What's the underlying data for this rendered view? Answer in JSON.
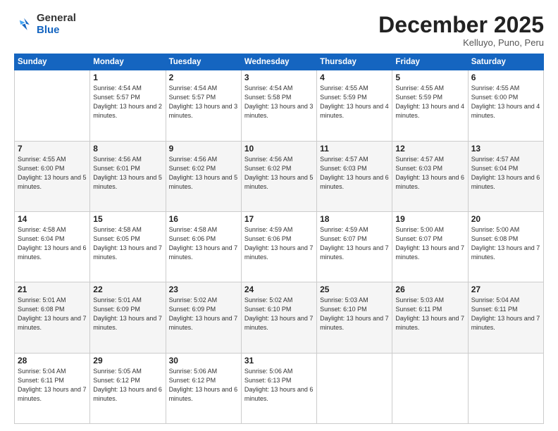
{
  "logo": {
    "general": "General",
    "blue": "Blue"
  },
  "header": {
    "month": "December 2025",
    "location": "Kelluyo, Puno, Peru"
  },
  "days_of_week": [
    "Sunday",
    "Monday",
    "Tuesday",
    "Wednesday",
    "Thursday",
    "Friday",
    "Saturday"
  ],
  "weeks": [
    [
      null,
      {
        "day": 1,
        "sunrise": "4:54 AM",
        "sunset": "5:57 PM",
        "daylight": "13 hours and 2 minutes."
      },
      {
        "day": 2,
        "sunrise": "4:54 AM",
        "sunset": "5:57 PM",
        "daylight": "13 hours and 3 minutes."
      },
      {
        "day": 3,
        "sunrise": "4:54 AM",
        "sunset": "5:58 PM",
        "daylight": "13 hours and 3 minutes."
      },
      {
        "day": 4,
        "sunrise": "4:55 AM",
        "sunset": "5:59 PM",
        "daylight": "13 hours and 4 minutes."
      },
      {
        "day": 5,
        "sunrise": "4:55 AM",
        "sunset": "5:59 PM",
        "daylight": "13 hours and 4 minutes."
      },
      {
        "day": 6,
        "sunrise": "4:55 AM",
        "sunset": "6:00 PM",
        "daylight": "13 hours and 4 minutes."
      }
    ],
    [
      {
        "day": 7,
        "sunrise": "4:55 AM",
        "sunset": "6:00 PM",
        "daylight": "13 hours and 5 minutes."
      },
      {
        "day": 8,
        "sunrise": "4:56 AM",
        "sunset": "6:01 PM",
        "daylight": "13 hours and 5 minutes."
      },
      {
        "day": 9,
        "sunrise": "4:56 AM",
        "sunset": "6:02 PM",
        "daylight": "13 hours and 5 minutes."
      },
      {
        "day": 10,
        "sunrise": "4:56 AM",
        "sunset": "6:02 PM",
        "daylight": "13 hours and 5 minutes."
      },
      {
        "day": 11,
        "sunrise": "4:57 AM",
        "sunset": "6:03 PM",
        "daylight": "13 hours and 6 minutes."
      },
      {
        "day": 12,
        "sunrise": "4:57 AM",
        "sunset": "6:03 PM",
        "daylight": "13 hours and 6 minutes."
      },
      {
        "day": 13,
        "sunrise": "4:57 AM",
        "sunset": "6:04 PM",
        "daylight": "13 hours and 6 minutes."
      }
    ],
    [
      {
        "day": 14,
        "sunrise": "4:58 AM",
        "sunset": "6:04 PM",
        "daylight": "13 hours and 6 minutes."
      },
      {
        "day": 15,
        "sunrise": "4:58 AM",
        "sunset": "6:05 PM",
        "daylight": "13 hours and 7 minutes."
      },
      {
        "day": 16,
        "sunrise": "4:58 AM",
        "sunset": "6:06 PM",
        "daylight": "13 hours and 7 minutes."
      },
      {
        "day": 17,
        "sunrise": "4:59 AM",
        "sunset": "6:06 PM",
        "daylight": "13 hours and 7 minutes."
      },
      {
        "day": 18,
        "sunrise": "4:59 AM",
        "sunset": "6:07 PM",
        "daylight": "13 hours and 7 minutes."
      },
      {
        "day": 19,
        "sunrise": "5:00 AM",
        "sunset": "6:07 PM",
        "daylight": "13 hours and 7 minutes."
      },
      {
        "day": 20,
        "sunrise": "5:00 AM",
        "sunset": "6:08 PM",
        "daylight": "13 hours and 7 minutes."
      }
    ],
    [
      {
        "day": 21,
        "sunrise": "5:01 AM",
        "sunset": "6:08 PM",
        "daylight": "13 hours and 7 minutes."
      },
      {
        "day": 22,
        "sunrise": "5:01 AM",
        "sunset": "6:09 PM",
        "daylight": "13 hours and 7 minutes."
      },
      {
        "day": 23,
        "sunrise": "5:02 AM",
        "sunset": "6:09 PM",
        "daylight": "13 hours and 7 minutes."
      },
      {
        "day": 24,
        "sunrise": "5:02 AM",
        "sunset": "6:10 PM",
        "daylight": "13 hours and 7 minutes."
      },
      {
        "day": 25,
        "sunrise": "5:03 AM",
        "sunset": "6:10 PM",
        "daylight": "13 hours and 7 minutes."
      },
      {
        "day": 26,
        "sunrise": "5:03 AM",
        "sunset": "6:11 PM",
        "daylight": "13 hours and 7 minutes."
      },
      {
        "day": 27,
        "sunrise": "5:04 AM",
        "sunset": "6:11 PM",
        "daylight": "13 hours and 7 minutes."
      }
    ],
    [
      {
        "day": 28,
        "sunrise": "5:04 AM",
        "sunset": "6:11 PM",
        "daylight": "13 hours and 7 minutes."
      },
      {
        "day": 29,
        "sunrise": "5:05 AM",
        "sunset": "6:12 PM",
        "daylight": "13 hours and 6 minutes."
      },
      {
        "day": 30,
        "sunrise": "5:06 AM",
        "sunset": "6:12 PM",
        "daylight": "13 hours and 6 minutes."
      },
      {
        "day": 31,
        "sunrise": "5:06 AM",
        "sunset": "6:13 PM",
        "daylight": "13 hours and 6 minutes."
      },
      null,
      null,
      null
    ]
  ]
}
